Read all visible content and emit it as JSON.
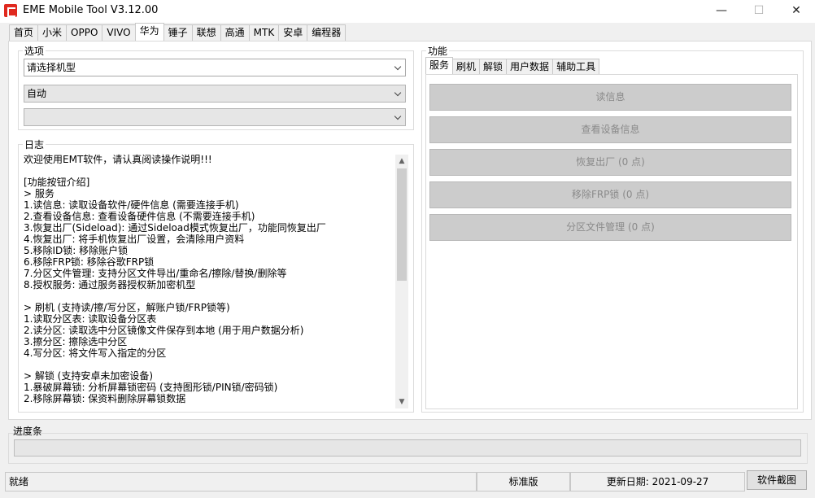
{
  "window": {
    "title": "EME Mobile Tool V3.12.00",
    "minimize": "—",
    "maximize": "☐",
    "close": "✕"
  },
  "tabs": [
    "首页",
    "小米",
    "OPPO",
    "VIVO",
    "华为",
    "锤子",
    "联想",
    "高通",
    "MTK",
    "安卓",
    "编程器"
  ],
  "active_tab": "华为",
  "options": {
    "title": "选项",
    "model_select": "请选择机型",
    "mode_select": "自动",
    "third_select": ""
  },
  "log": {
    "title": "日志",
    "lines": [
      "欢迎使用EMT软件，请认真阅读操作说明!!!",
      "",
      "[功能按钮介绍]",
      "> 服务",
      "1.读信息: 读取设备软件/硬件信息 (需要连接手机)",
      "2.查看设备信息: 查看设备硬件信息 (不需要连接手机)",
      "3.恢复出厂(Sideload): 通过Sideload模式恢复出厂，功能同恢复出厂",
      "4.恢复出厂: 将手机恢复出厂设置，会清除用户资料",
      "5.移除ID锁: 移除账户锁",
      "6.移除FRP锁: 移除谷歌FRP锁",
      "7.分区文件管理: 支持分区文件导出/重命名/擦除/替换/删除等",
      "8.授权服务: 通过服务器授权新加密机型",
      "",
      "> 刷机 (支持读/擦/写分区，解账户锁/FRP锁等)",
      "1.读取分区表: 读取设备分区表",
      "2.读分区: 读取选中分区镜像文件保存到本地 (用于用户数据分析)",
      "3.擦分区: 擦除选中分区",
      "4.写分区: 将文件写入指定的分区",
      "",
      "> 解锁 (支持安卓未加密设备)",
      "1.暴破屏幕锁: 分析屏幕锁密码 (支持图形锁/PIN锁/密码锁)",
      "2.移除屏幕锁: 保资料删除屏幕锁数据"
    ]
  },
  "functions": {
    "title": "功能",
    "tabs": [
      "服务",
      "刷机",
      "解锁",
      "用户数据",
      "辅助工具"
    ],
    "active_tab": "服务",
    "buttons": [
      "读信息",
      "查看设备信息",
      "恢复出厂 (0 点)",
      "移除FRP锁 (0 点)",
      "分区文件管理 (0 点)"
    ]
  },
  "progress": {
    "title": "进度条",
    "value": 0
  },
  "status": {
    "state": "就绪",
    "edition": "标准版",
    "update_label": "更新日期:",
    "update_date": "2021-09-27",
    "screenshot_button": "软件截图"
  }
}
